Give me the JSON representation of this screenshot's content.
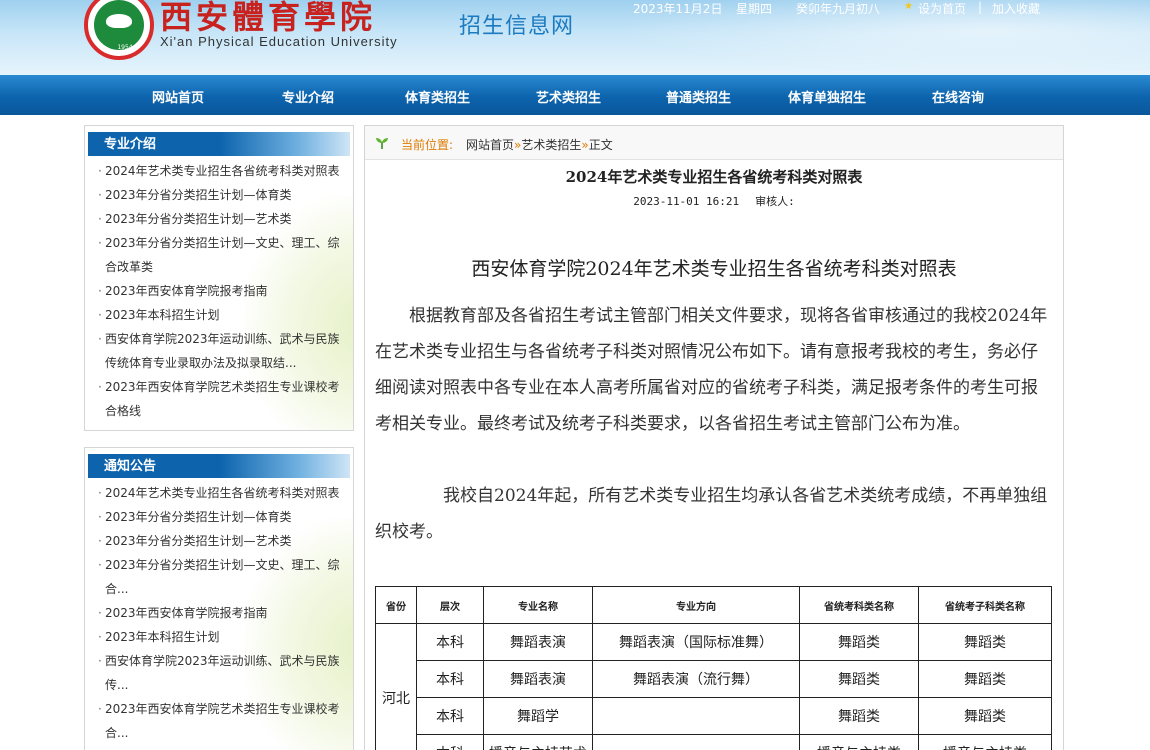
{
  "header": {
    "school_cn": "西安體育學院",
    "school_en": "Xi'an Physical Education University",
    "logo_year": "1954",
    "site_name": "招生信息网",
    "date": "2023年11月2日",
    "weekday": "星期四",
    "lunar": "癸卯年九月初八",
    "set_home": "设为首页",
    "separator": "|",
    "add_favorite": "加入收藏"
  },
  "nav": [
    "网站首页",
    "专业介绍",
    "体育类招生",
    "艺术类招生",
    "普通类招生",
    "体育单独招生",
    "在线咨询"
  ],
  "sidebar": {
    "intro": {
      "title": "专业介绍",
      "items": [
        "2024年艺术类专业招生各省统考科类对照表",
        "2023年分省分类招生计划—体育类",
        "2023年分省分类招生计划—艺术类",
        "2023年分省分类招生计划—文史、理工、综合改革类",
        "2023年西安体育学院报考指南",
        "2023年本科招生计划",
        "西安体育学院2023年运动训练、武术与民族传统体育专业录取办法及拟录取结...",
        "2023年西安体育学院艺术类招生专业课校考合格线"
      ]
    },
    "notice": {
      "title": "通知公告",
      "items": [
        "2024年艺术类专业招生各省统考科类对照表",
        "2023年分省分类招生计划—体育类",
        "2023年分省分类招生计划—艺术类",
        "2023年分省分类招生计划—文史、理工、综合...",
        "2023年西安体育学院报考指南",
        "2023年本科招生计划",
        "西安体育学院2023年运动训练、武术与民族传...",
        "2023年西安体育学院艺术类招生专业课校考合..."
      ]
    }
  },
  "breadcrumb": {
    "label": "当前位置:",
    "home": "网站首页",
    "sep": "»",
    "section": "艺术类招生",
    "current": "正文"
  },
  "article": {
    "title": "2024年艺术类专业招生各省统考科类对照表",
    "date": "2023-11-01 16:21",
    "reviewer": "审核人:",
    "content_title": "西安体育学院2024年艺术类专业招生各省统考科类对照表",
    "para1": "根据教育部及各省招生考试主管部门相关文件要求，现将各省审核通过的我校2024年在艺术类专业招生与各省统考子科类对照情况公布如下。请有意报考我校的考生，务必仔细阅读对照表中各专业在本人高考所属省对应的省统考子科类，满足报考条件的考生可报考相关专业。最终考试及统考子科类要求，以各省招生考试主管部门公布为准。",
    "para2": "我校自2024年起，所有艺术类专业招生均承认各省艺术类统考成绩，不再单独组织校考。"
  },
  "table": {
    "headers": [
      "省份",
      "层次",
      "专业名称",
      "专业方向",
      "省统考科类名称",
      "省统考子科类名称"
    ],
    "province": "河北",
    "rows": [
      [
        "本科",
        "舞蹈表演",
        "舞蹈表演（国际标准舞）",
        "舞蹈类",
        "舞蹈类"
      ],
      [
        "本科",
        "舞蹈表演",
        "舞蹈表演（流行舞）",
        "舞蹈类",
        "舞蹈类"
      ],
      [
        "本科",
        "舞蹈学",
        "",
        "舞蹈类",
        "舞蹈类"
      ],
      [
        "本科",
        "播音与主持艺术",
        "",
        "播音与主持类",
        "播音与主持类"
      ]
    ]
  }
}
